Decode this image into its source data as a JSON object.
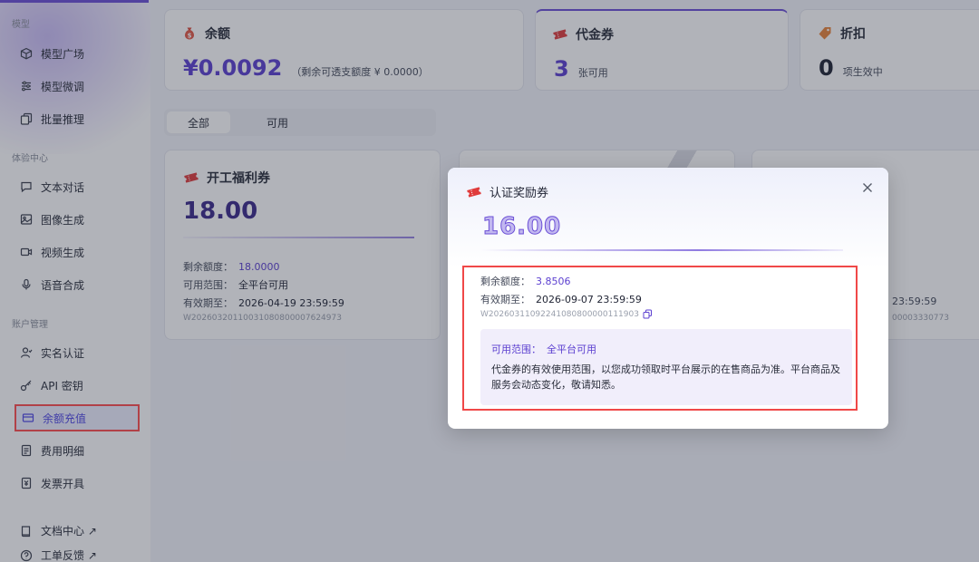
{
  "colors": {
    "accent": "#5b3fd0",
    "highlight_border": "#f04848",
    "overlay": "rgba(40,44,60,0.36)"
  },
  "sidebar": {
    "sections": [
      {
        "label": "模型",
        "items": [
          {
            "label": "模型广场",
            "icon": "cube-icon"
          },
          {
            "label": "模型微调",
            "icon": "sliders-icon"
          },
          {
            "label": "批量推理",
            "icon": "copy-icon"
          }
        ]
      },
      {
        "label": "体验中心",
        "items": [
          {
            "label": "文本对话",
            "icon": "chat-icon"
          },
          {
            "label": "图像生成",
            "icon": "image-icon"
          },
          {
            "label": "视频生成",
            "icon": "video-icon"
          },
          {
            "label": "语音合成",
            "icon": "mic-icon"
          }
        ]
      },
      {
        "label": "账户管理",
        "items": [
          {
            "label": "实名认证",
            "icon": "user-icon"
          },
          {
            "label": "API 密钥",
            "icon": "key-icon"
          },
          {
            "label": "余额充值",
            "icon": "card-icon",
            "active": true
          },
          {
            "label": "费用明细",
            "icon": "document-icon"
          },
          {
            "label": "发票开具",
            "icon": "invoice-icon"
          }
        ]
      }
    ],
    "links": [
      {
        "label": "文档中心 ↗",
        "icon": "book-icon"
      },
      {
        "label": "工单反馈 ↗",
        "icon": "help-icon"
      }
    ]
  },
  "stats": {
    "balance": {
      "title": "余额",
      "value": "¥0.0092",
      "sub": "（剩余可透支额度 ¥ 0.0000）",
      "icon": "money-bag-icon"
    },
    "voucher": {
      "title": "代金券",
      "value": "3",
      "sub": "张可用",
      "icon": "ticket-icon"
    },
    "discount": {
      "title": "折扣",
      "value": "0",
      "sub": "项生效中",
      "icon": "tag-icon"
    }
  },
  "tabs": [
    "全部",
    "可用"
  ],
  "voucher_cards": [
    {
      "title": "开工福利券",
      "amount": "18.00",
      "remaining_label": "剩余额度：",
      "remaining": "18.0000",
      "scope_label": "可用范围：",
      "scope": "全平台可用",
      "expiry_label": "有效期至：",
      "expiry": "2026-04-19 23:59:59",
      "code": "W20260320110031080800007624973"
    },
    {
      "expiry_partial": "23:59:59",
      "code_partial": "00003330773"
    }
  ],
  "modal": {
    "title": "认证奖励券",
    "amount": "16.00",
    "remaining_label": "剩余额度：",
    "remaining": "3.8506",
    "expiry_label": "有效期至：",
    "expiry": "2026-09-07 23:59:59",
    "code": "W20260311092241080800000111903",
    "scope_label": "可用范围：",
    "scope": "全平台可用",
    "scope_desc": "代金券的有效使用范围，以您成功领取时平台展示的在售商品为准。平台商品及服务会动态变化，敬请知悉。"
  }
}
